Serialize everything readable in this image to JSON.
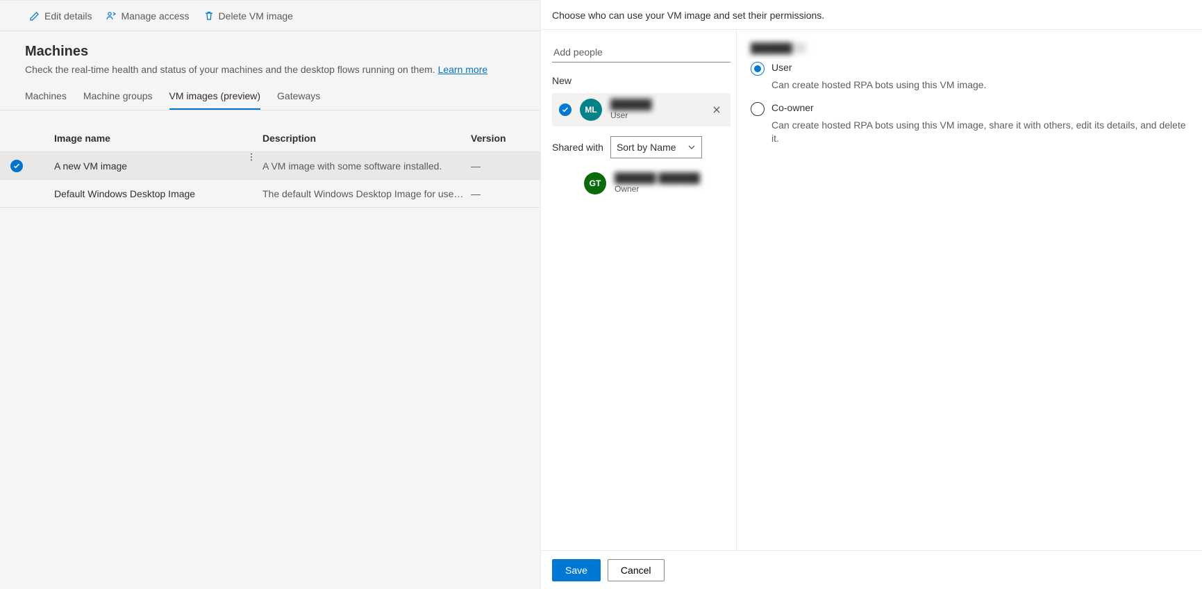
{
  "toolbar": {
    "edit_label": "Edit details",
    "manage_label": "Manage access",
    "delete_label": "Delete VM image"
  },
  "page": {
    "title": "Machines",
    "subtitle_prefix": "Check the real-time health and status of your machines and the desktop flows running on them. ",
    "learn_more": "Learn more"
  },
  "tabs": [
    {
      "label": "Machines",
      "active": false
    },
    {
      "label": "Machine groups",
      "active": false
    },
    {
      "label": "VM images (preview)",
      "active": true
    },
    {
      "label": "Gateways",
      "active": false
    }
  ],
  "table": {
    "headers": {
      "name": "Image name",
      "desc": "Description",
      "version": "Version"
    },
    "rows": [
      {
        "selected": true,
        "name": "A new VM image",
        "desc": "A VM image with some software installed.",
        "version": "—"
      },
      {
        "selected": false,
        "name": "Default Windows Desktop Image",
        "desc": "The default Windows Desktop Image for use in the Product ...",
        "version": "—"
      }
    ]
  },
  "panel": {
    "header": "Choose who can use your VM image and set their permissions.",
    "add_placeholder": "Add people",
    "new_label": "New",
    "shared_with_label": "Shared with",
    "sort_label": "Sort by Name",
    "new_person": {
      "initials": "ML",
      "name": "██████",
      "role": "User"
    },
    "owner": {
      "initials": "GT",
      "name": "██████ ██████",
      "role": "Owner"
    },
    "perm_title": "██████",
    "permissions": {
      "user": {
        "label": "User",
        "desc": "Can create hosted RPA bots using this VM image.",
        "checked": true
      },
      "coowner": {
        "label": "Co-owner",
        "desc": "Can create hosted RPA bots using this VM image, share it with others, edit its details, and delete it.",
        "checked": false
      }
    },
    "save_label": "Save",
    "cancel_label": "Cancel"
  }
}
